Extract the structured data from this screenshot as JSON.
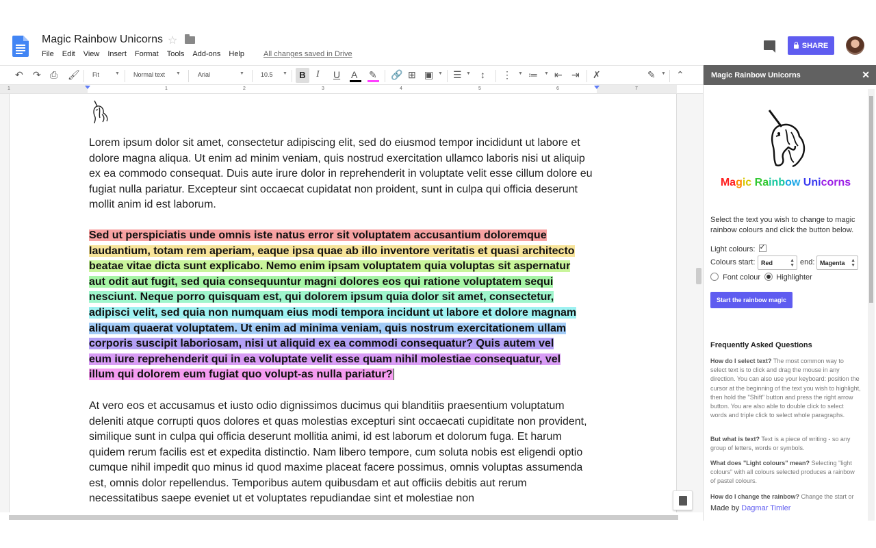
{
  "header": {
    "doc_title": "Magic Rainbow Unicorns",
    "menu": [
      "File",
      "Edit",
      "View",
      "Insert",
      "Format",
      "Tools",
      "Add-ons",
      "Help"
    ],
    "save_status": "All changes saved in Drive",
    "share_label": "SHARE",
    "share_color": "#5f5cf0"
  },
  "toolbar": {
    "zoom": "Fit",
    "style": "Normal text",
    "font": "Arial",
    "font_size": "10.5",
    "bold_glyph": "B",
    "italic_glyph": "I",
    "underline_glyph": "U",
    "text_color_glyph": "A",
    "text_color": "#000000",
    "highlight_color": "#ff40ff"
  },
  "ruler": [
    "1",
    "1",
    "2",
    "3",
    "4",
    "5",
    "6",
    "7"
  ],
  "document": {
    "para1": "Lorem ipsum dolor sit amet, consectetur adipiscing elit, sed do eiusmod tempor incididunt ut labore et dolore magna aliqua. Ut enim ad minim veniam, quis nostrud exercitation ullamco laboris nisi ut aliquip ex ea commodo consequat. Duis aute irure dolor in reprehenderit in voluptate velit esse cillum dolore eu fugiat nulla pariatur. Excepteur sint occaecat cupidatat non proident, sunt in culpa qui officia deserunt mollit anim id est laborum.",
    "rainbow_lines": [
      {
        "text": "Sed ut perspiciatis unde omnis iste natus error sit voluptatem accusantium doloremque",
        "color": "#f7a2a2"
      },
      {
        "text": "laudantium, totam rem aperiam, eaque ipsa quae ab illo inventore veritatis et quasi architecto",
        "color": "#f7e49a"
      },
      {
        "text": "beatae vitae dicta sunt explicabo. Nemo enim ipsam voluptatem quia voluptas sit aspernatur",
        "color": "#c9f59b"
      },
      {
        "text": "aut odit aut fugit, sed quia consequuntur magni dolores eos qui ratione voluptatem sequi",
        "color": "#a6f5a6"
      },
      {
        "text": "nesciunt. Neque porro quisquam est, qui dolorem ipsum quia dolor sit amet, consectetur,",
        "color": "#9ff5cc"
      },
      {
        "text": "adipisci velit, sed quia non numquam eius modi tempora incidunt ut labore et dolore magnam",
        "color": "#9ff2f2"
      },
      {
        "text": "aliquam quaerat voluptatem. Ut enim ad minima veniam, quis nostrum exercitationem ullam",
        "color": "#a3ccf7"
      },
      {
        "text": "corporis suscipit laboriosam, nisi ut aliquid ex ea commodi consequatur? Quis autem vel",
        "color": "#b39ff5"
      },
      {
        "text": "eum iure reprehenderit qui in ea voluptate velit esse quam nihil molestiae consequatur, vel",
        "color": "#d89cf5"
      },
      {
        "text": "illum qui dolorem eum fugiat quo volupt-as nulla pariatur?",
        "color": "#f59cf0"
      }
    ],
    "para3": "At vero eos et accusamus et iusto odio dignissimos ducimus qui blanditiis praesentium voluptatum deleniti atque corrupti quos dolores et quas molestias excepturi sint occaecati cupiditate non provident, similique sunt in culpa qui officia deserunt mollitia animi, id est laborum et dolorum fuga. Et harum quidem rerum facilis est et expedita distinctio. Nam libero tempore, cum soluta nobis est eligendi optio cumque nihil impedit quo minus id quod maxime placeat facere possimus, omnis voluptas assumenda est, omnis dolor repellendus. Temporibus autem quibusdam et aut officiis debitis aut rerum necessitatibus saepe eveniet ut et voluptates repudiandae sint et molestiae non"
  },
  "sidebar": {
    "title": "Magic Rainbow Unicorns",
    "close_glyph": "✕",
    "rainbow_heading": [
      {
        "t": "Ma",
        "c": "#ff2020"
      },
      {
        "t": "g",
        "c": "#ff8a00"
      },
      {
        "t": "ic ",
        "c": "#d6c600"
      },
      {
        "t": "Ra",
        "c": "#32c832"
      },
      {
        "t": "inb",
        "c": "#19c8a0"
      },
      {
        "t": "ow ",
        "c": "#1aa6e6"
      },
      {
        "t": "Uni",
        "c": "#3a3af0"
      },
      {
        "t": "corns",
        "c": "#9b1ee6"
      }
    ],
    "instructions": "Select the text you wish to change to magic rainbow colours and click the button below.",
    "light_colours_label": "Light colours:",
    "colours_start_label": "Colours start:",
    "start_value": "Red",
    "end_label": "end:",
    "end_value": "Magenta",
    "font_colour_label": "Font colour",
    "highlighter_label": "Highlighter",
    "button_label": "Start the rainbow magic",
    "faq_title": "Frequently Asked Questions",
    "faq": [
      {
        "q": "How do I select text?",
        "a": " The most common way to select text is to click and drag the mouse in any direction. You can also use your keyboard: position the cursor at the beginning of the text you wish to highlight, then hold the \"Shift\" button and press the right arrow button. You are also able to double click to select words and triple click to select whole paragraphs."
      },
      {
        "q": "But what is text?",
        "a": " Text is a piece of writing - so any group of letters, words or symbols."
      },
      {
        "q": "What does \"Light colours\" mean?",
        "a": " Selecting \"light colours\" with all colours selected produces a rainbow of pastel colours."
      },
      {
        "q": "How do I change the rainbow?",
        "a": " Change the start or"
      }
    ],
    "made_by_label": "Made by ",
    "made_by_name": "Dagmar Timler"
  }
}
